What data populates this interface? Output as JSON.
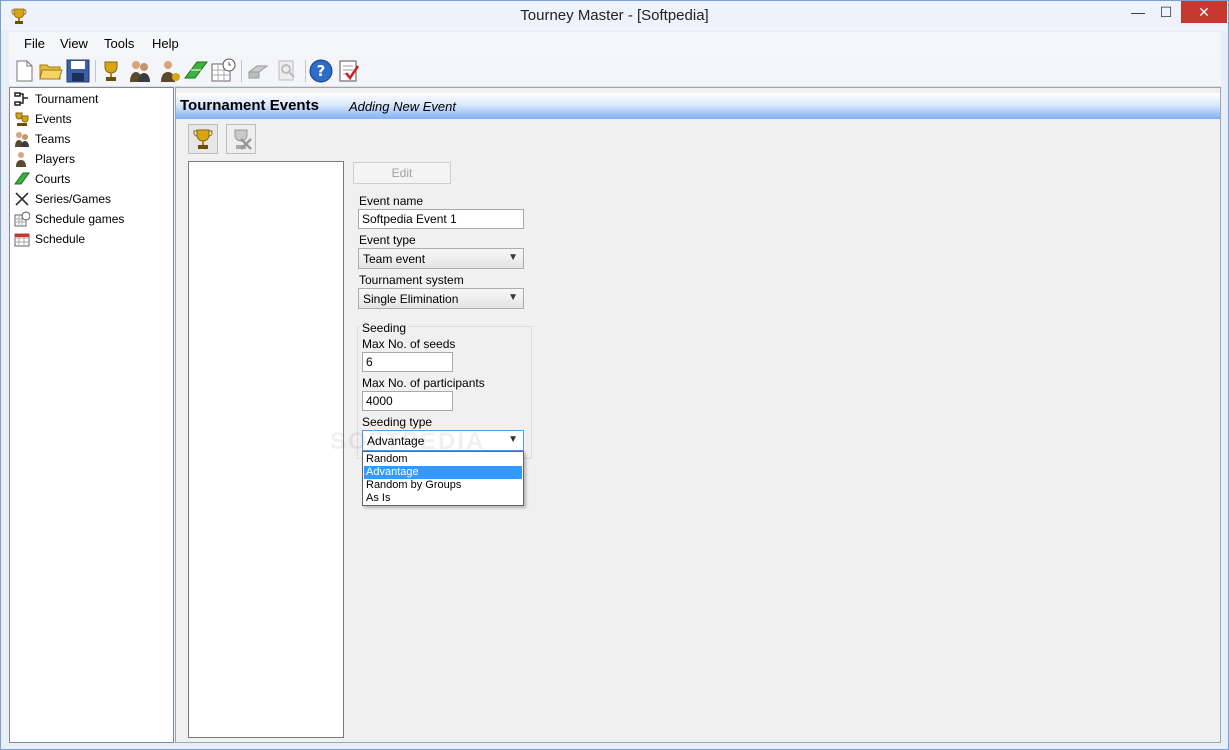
{
  "window": {
    "title": "Tourney Master - [Softpedia]",
    "min": "—",
    "max": "☐",
    "close": "✕"
  },
  "menu": [
    "File",
    "View",
    "Tools",
    "Help"
  ],
  "toolbar": [
    {
      "name": "new-file-icon"
    },
    {
      "name": "open-folder-icon"
    },
    {
      "name": "save-icon"
    },
    {
      "name": "trophy-icon"
    },
    {
      "name": "teams-icon"
    },
    {
      "name": "players-icon"
    },
    {
      "name": "courts-icon"
    },
    {
      "name": "schedule-games-icon"
    },
    {
      "name": "print-icon"
    },
    {
      "name": "print-preview-icon"
    },
    {
      "name": "help-icon"
    },
    {
      "name": "checklist-icon"
    }
  ],
  "nav": {
    "items": [
      {
        "label": "Tournament",
        "icon": "tournament-icon"
      },
      {
        "label": "Events",
        "icon": "events-icon"
      },
      {
        "label": "Teams",
        "icon": "teams-icon"
      },
      {
        "label": "Players",
        "icon": "players-icon"
      },
      {
        "label": "Courts",
        "icon": "courts-icon"
      },
      {
        "label": "Series/Games",
        "icon": "series-games-icon"
      },
      {
        "label": "Schedule games",
        "icon": "schedule-games-icon"
      },
      {
        "label": "Schedule",
        "icon": "schedule-icon"
      }
    ],
    "selected": "Events"
  },
  "header": {
    "title": "Tournament Events",
    "subtitle": "Adding New Event"
  },
  "form": {
    "edit_label": "Edit",
    "event_name_label": "Event name",
    "event_name_value": "Softpedia Event 1",
    "event_type_label": "Event type",
    "event_type_value": "Team event",
    "system_label": "Tournament system",
    "system_value": "Single Elimination",
    "seeding_title": "Seeding",
    "max_seeds_label": "Max No. of seeds",
    "max_seeds_value": "6",
    "max_participants_label": "Max No. of participants",
    "max_participants_value": "4000",
    "seeding_type_label": "Seeding type",
    "seeding_type_value": "Advantage",
    "seeding_options": [
      "Random",
      "Advantage",
      "Random by Groups",
      "As Is"
    ]
  },
  "watermark": "SOFTPEDIA",
  "colors": {
    "accent": "#3399ff",
    "header_gradient_end": "#7fb0f5",
    "close_button": "#c7392f"
  }
}
